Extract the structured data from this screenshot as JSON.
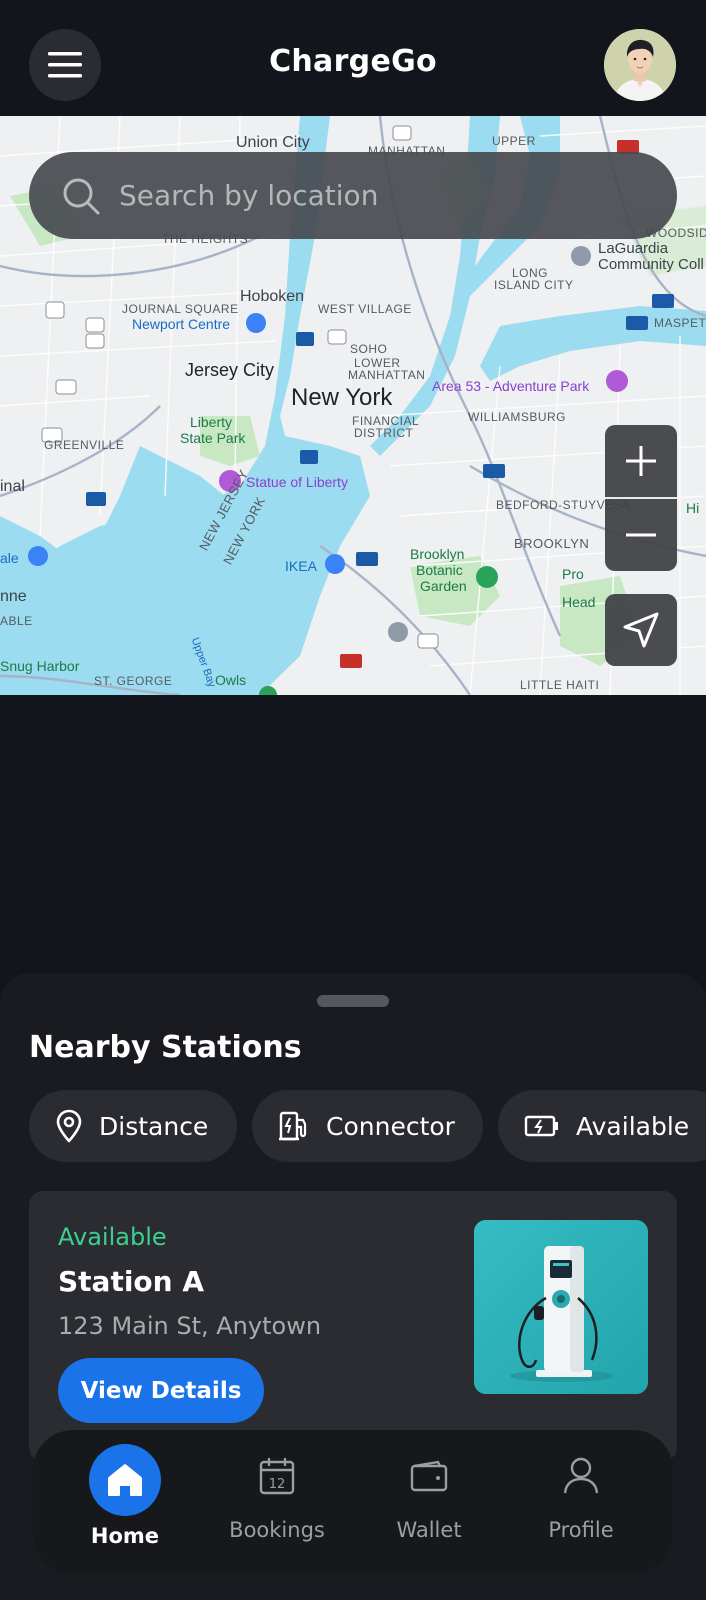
{
  "header": {
    "title": "ChargeGo",
    "menu_icon": "hamburger-menu-icon",
    "avatar_icon": "user-avatar"
  },
  "search": {
    "placeholder": "Search by location",
    "icon": "search-icon"
  },
  "map": {
    "labels": {
      "union_city": "Union City",
      "manhattan": "MANHATTAN",
      "upper": "UPPER",
      "the_heights": "THE HEIGHTS",
      "hoboken": "Hoboken",
      "journal_square": "JOURNAL SQUARE",
      "newport_centre": "Newport Centre",
      "west_village": "WEST VILLAGE",
      "soho": "SOHO",
      "lower": "LOWER",
      "manhattan2": "MANHATTAN",
      "jersey_city": "Jersey City",
      "new_york": "New York",
      "financial": "FINANCIAL",
      "district": "DISTRICT",
      "liberty": "Liberty",
      "state_park": "State Park",
      "statue": "Statue of Liberty",
      "greenville": "GREENVILLE",
      "laguardia": "LaGuardia",
      "community": "Community Coll",
      "woodside": "WOODSIDE",
      "long": "LONG",
      "island_city": "ISLAND CITY",
      "maspeth": "MASPETH",
      "area53": "Area 53 - Adventure Park",
      "williamsburg": "WILLIAMSBURG",
      "bedford": "BEDFORD-STUYVESA",
      "brooklyn": "BROOKLYN",
      "brooklyn_garden_1": "Brooklyn",
      "brooklyn_garden_2": "Botanic",
      "brooklyn_garden_3": "Garden",
      "ikea": "IKEA",
      "new_jersey": "NEW JERSEY",
      "new_york_state": "NEW YORK",
      "upper_bay": "Upper Bay",
      "prospect": "Pro",
      "head": "Head",
      "snug_harbor": "Snug Harbor",
      "st_george": "ST. GEORGE",
      "owls": "Owls",
      "little_haiti": "LITTLE HAITI",
      "inal": "inal",
      "ale": "ale",
      "nne": "nne",
      "able": "ABLE",
      "hi": "Hi"
    },
    "zoom_in_icon": "plus-icon",
    "zoom_out_icon": "minus-icon",
    "locate_icon": "navigation-arrow-icon"
  },
  "sheet": {
    "title": "Nearby Stations",
    "chips": [
      {
        "label": "Distance",
        "icon": "location-pin-icon"
      },
      {
        "label": "Connector",
        "icon": "ev-charger-icon"
      },
      {
        "label": "Available",
        "icon": "battery-charging-icon"
      }
    ],
    "station": {
      "status": "Available",
      "status_color": "#3ecf8e",
      "name": "Station A",
      "address": "123 Main St, Anytown",
      "button": "View Details",
      "image_icon": "ev-charging-station-image"
    }
  },
  "nav": {
    "items": [
      {
        "label": "Home",
        "icon": "home-icon",
        "active": true
      },
      {
        "label": "Bookings",
        "icon": "calendar-icon",
        "active": false
      },
      {
        "label": "Wallet",
        "icon": "wallet-icon",
        "active": false
      },
      {
        "label": "Profile",
        "icon": "person-icon",
        "active": false
      }
    ],
    "calendar_day": "12"
  },
  "colors": {
    "background": "#12151b",
    "accent": "#1a73e8",
    "available": "#3ecf8e",
    "surface": "#2a2c31"
  }
}
